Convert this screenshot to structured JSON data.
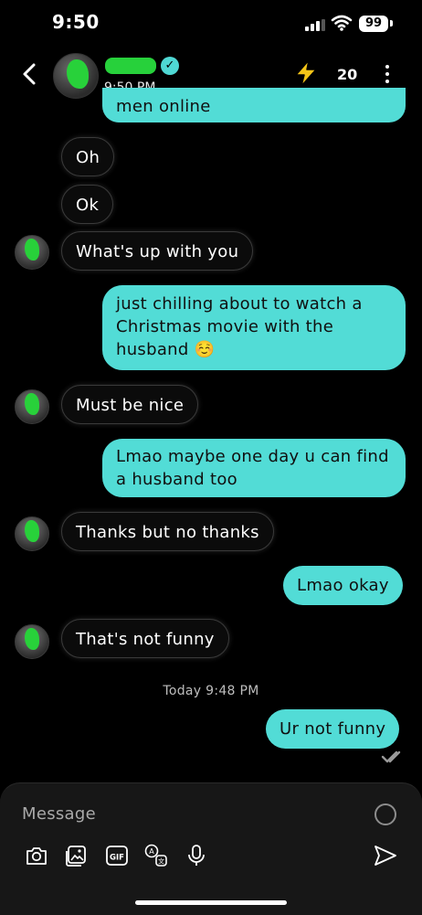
{
  "status_bar": {
    "time": "9:50",
    "battery": "99"
  },
  "header": {
    "status": "9:50 PM",
    "count": "20"
  },
  "messages": [
    {
      "side": "out",
      "text": "men online"
    },
    {
      "side": "in",
      "text": "Oh"
    },
    {
      "side": "in",
      "text": "Ok"
    },
    {
      "side": "in",
      "text": "What's up with you"
    },
    {
      "side": "out",
      "text": "just chilling about to watch a Christmas movie with the husband ☺️"
    },
    {
      "side": "in",
      "text": "Must be nice"
    },
    {
      "side": "out",
      "text": "Lmao maybe one day u can find a husband too"
    },
    {
      "side": "in",
      "text": "Thanks but no thanks"
    },
    {
      "side": "out",
      "text": "Lmao okay"
    },
    {
      "side": "in",
      "text": "That's not funny"
    },
    {
      "side": "out",
      "text": "Ur not funny"
    }
  ],
  "timestamp": "Today 9:48 PM",
  "composer": {
    "placeholder": "Message",
    "tools": [
      "camera-icon",
      "gallery-icon",
      "gif-icon",
      "translate-icon",
      "microphone-icon"
    ]
  },
  "colors": {
    "outgoing_bubble": "#52dcd6",
    "background": "#000000",
    "incoming_bubble": "#0b0b0b"
  }
}
